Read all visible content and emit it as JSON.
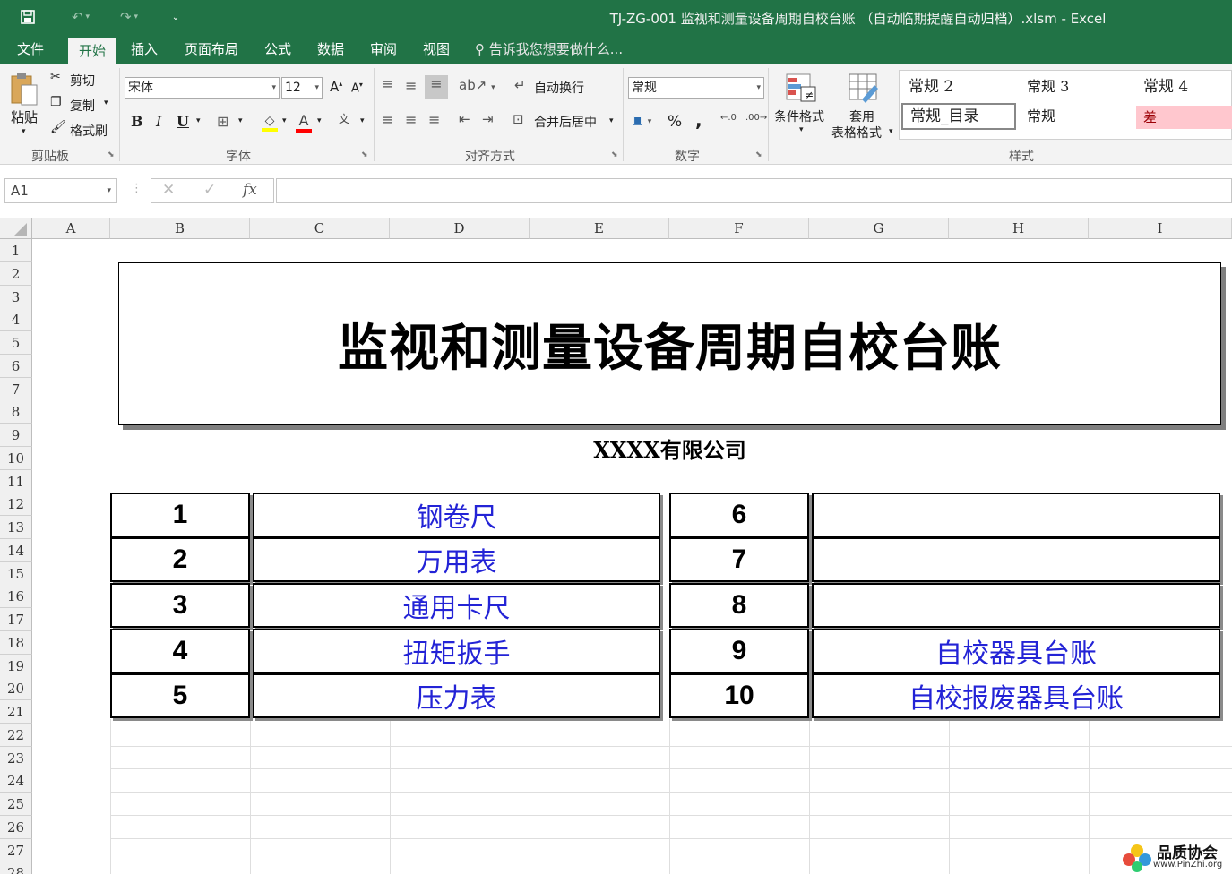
{
  "titlebar": {
    "title": "TJ-ZG-001 监视和测量设备周期自校台账 （自动临期提醒自动归档）.xlsm - Excel"
  },
  "tabs": [
    {
      "label": "文件"
    },
    {
      "label": "开始"
    },
    {
      "label": "插入"
    },
    {
      "label": "页面布局"
    },
    {
      "label": "公式"
    },
    {
      "label": "数据"
    },
    {
      "label": "审阅"
    },
    {
      "label": "视图"
    }
  ],
  "tell_me": "告诉我您想要做什么...",
  "ribbon": {
    "clipboard": {
      "paste": "粘贴",
      "cut": "剪切",
      "copy": "复制",
      "format_painter": "格式刷",
      "label": "剪贴板"
    },
    "font": {
      "name": "宋体",
      "size": "12",
      "label": "字体",
      "bold": "B",
      "italic": "I",
      "underline": "U"
    },
    "alignment": {
      "wrap": "自动换行",
      "merge": "合并后居中",
      "label": "对齐方式"
    },
    "number": {
      "format": "常规",
      "label": "数字",
      "percent": "%",
      "comma": ","
    },
    "styles": {
      "conditional": "条件格式",
      "table_line1": "套用",
      "table_line2": "表格格式",
      "label": "样式",
      "cells": [
        "常规 2",
        "常规 3",
        "常规 4",
        "常规_目录",
        "常规",
        "差"
      ]
    }
  },
  "formula_bar": {
    "name_box": "A1",
    "fx": "fx",
    "value": ""
  },
  "columns": [
    "A",
    "B",
    "C",
    "D",
    "E",
    "F",
    "G",
    "H",
    "I"
  ],
  "rows": [
    "1",
    "2",
    "3",
    "4",
    "5",
    "6",
    "7",
    "8",
    "9",
    "10",
    "11",
    "12",
    "13",
    "14",
    "15",
    "16",
    "17",
    "18",
    "19",
    "20",
    "21",
    "22",
    "23",
    "24",
    "25",
    "26",
    "27",
    "28"
  ],
  "sheet": {
    "title": "监视和测量设备周期自校台账",
    "company": "XXXX有限公司",
    "left_items": [
      {
        "no": "1",
        "name": "钢卷尺"
      },
      {
        "no": "2",
        "name": "万用表"
      },
      {
        "no": "3",
        "name": "通用卡尺"
      },
      {
        "no": "4",
        "name": "扭矩扳手"
      },
      {
        "no": "5",
        "name": "压力表"
      }
    ],
    "right_items": [
      {
        "no": "6",
        "name": ""
      },
      {
        "no": "7",
        "name": ""
      },
      {
        "no": "8",
        "name": ""
      },
      {
        "no": "9",
        "name": "自校器具台账"
      },
      {
        "no": "10",
        "name": "自校报废器具台账"
      }
    ]
  },
  "watermark": {
    "name": "品质协会",
    "url": "www.PinZhi.org"
  },
  "colors": {
    "excel_green": "#217346",
    "link_blue": "#2323d6",
    "bad_fill": "#ffc7ce"
  }
}
